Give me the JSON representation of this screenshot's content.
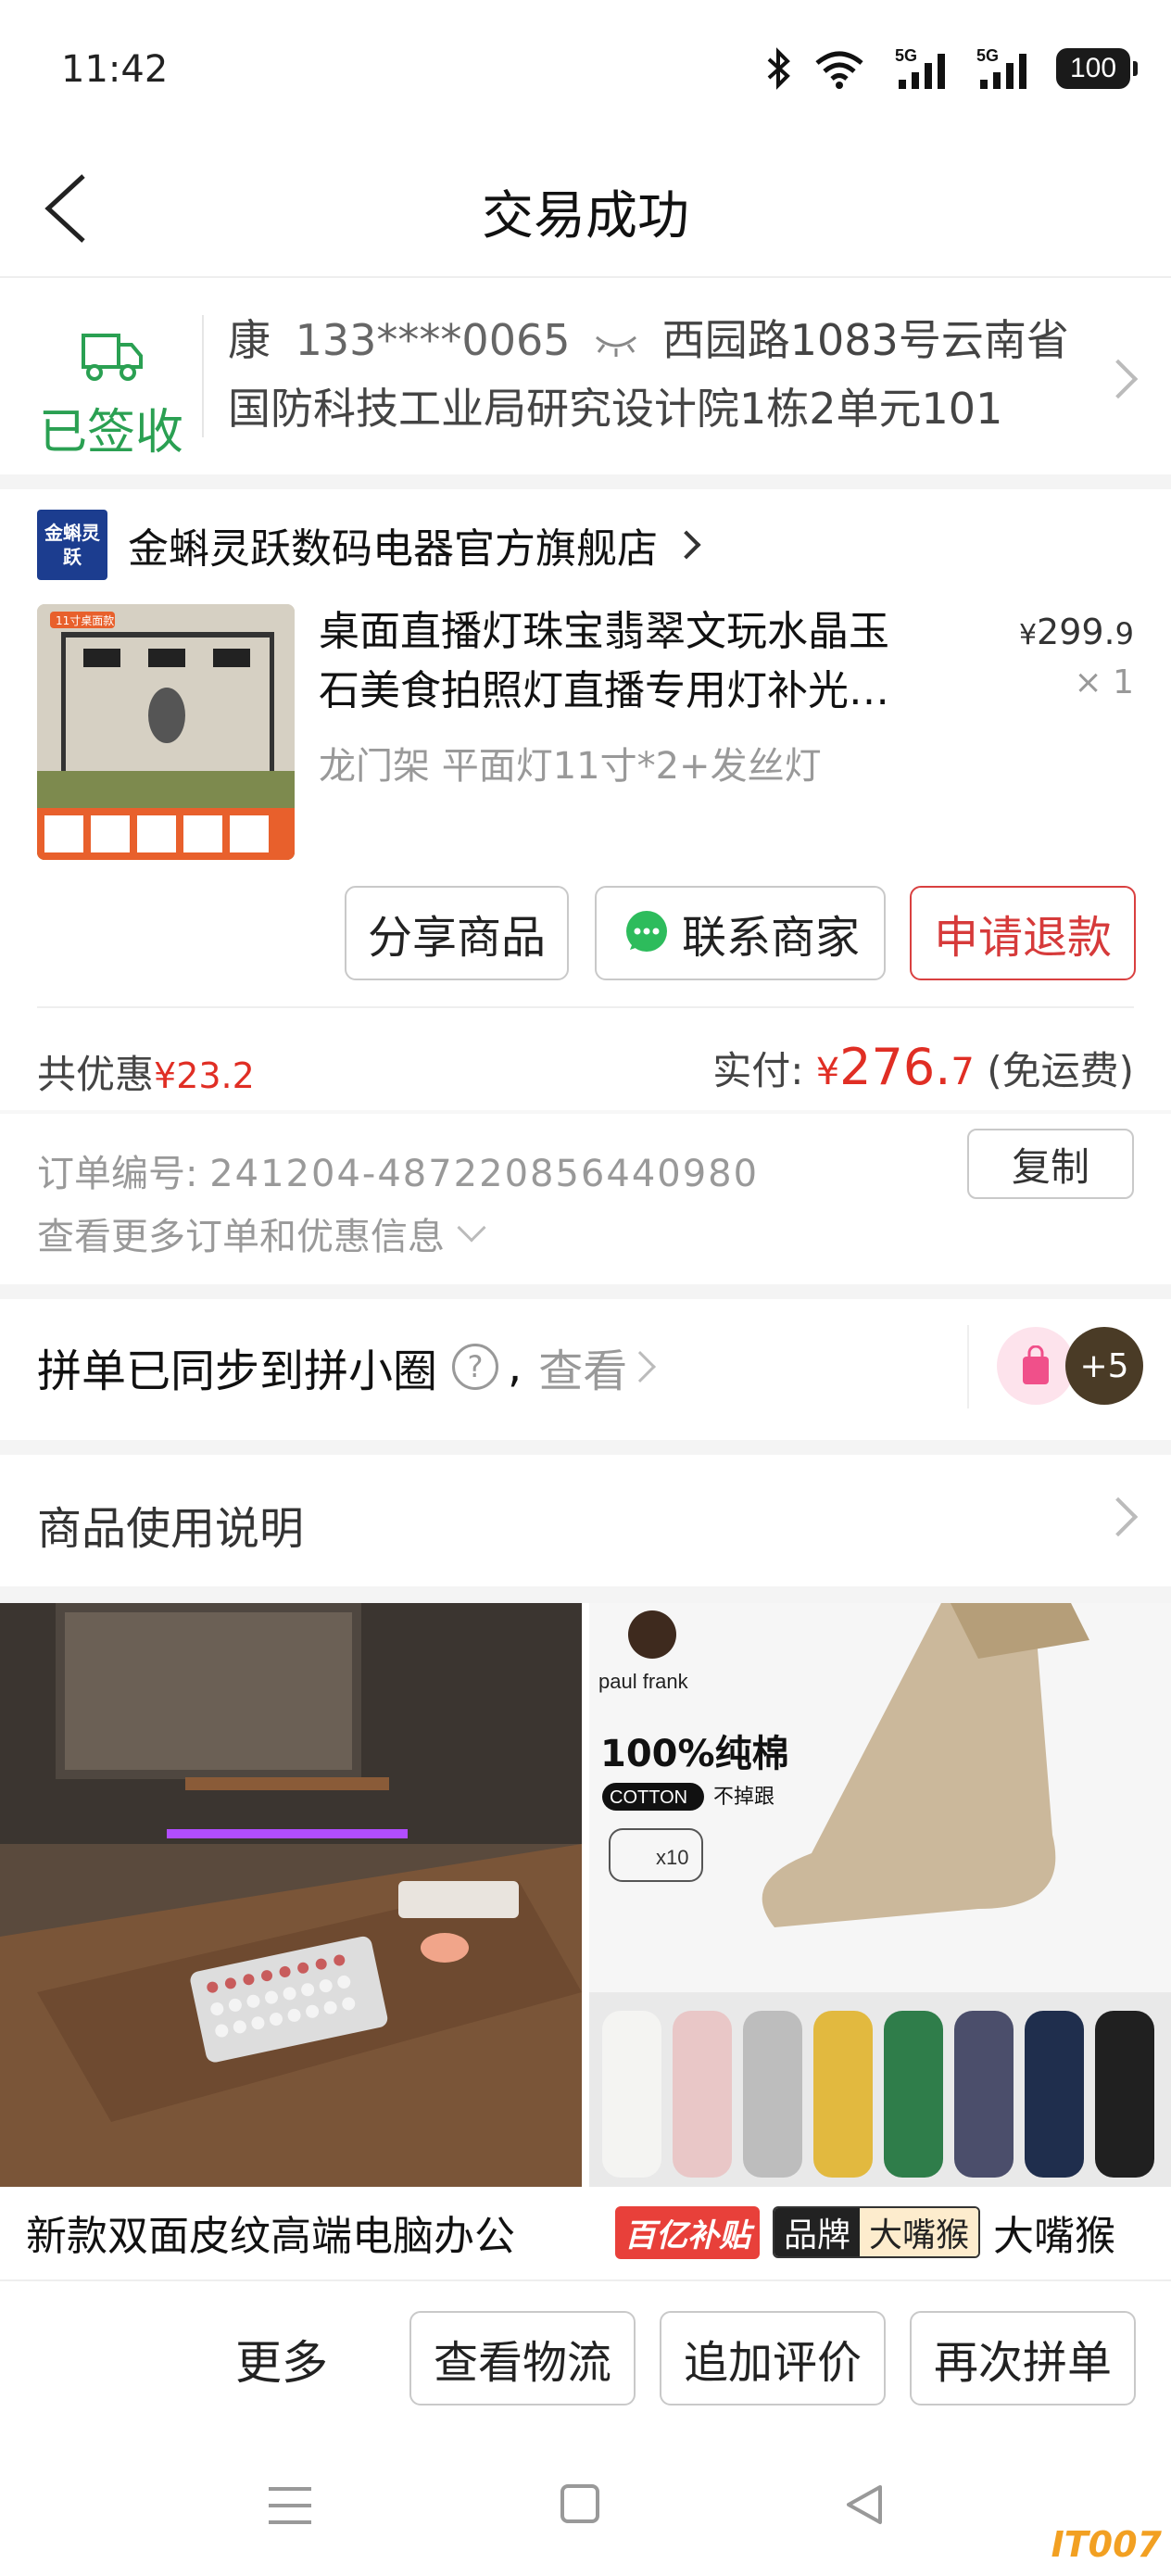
{
  "status_bar": {
    "time": "11:42",
    "battery": "100",
    "signal_label": "5G"
  },
  "nav": {
    "title": "交易成功"
  },
  "address": {
    "status": "已签收",
    "name": "康",
    "phone": "133****0065",
    "line1": "西园路1083号云南省",
    "line2": "国防科技工业局研究设计院1栋2单元101"
  },
  "shop": {
    "logo_text": "金蝌灵跃",
    "name": "金蝌灵跃数码电器官方旗舰店"
  },
  "product": {
    "thumb_badge": "11寸桌面款",
    "name_line1": "桌面直播灯珠宝翡翠文玩水晶玉",
    "name_line2": "石美食拍照灯直播专用灯补光…",
    "spec": "龙门架 平面灯11寸*2+发丝灯",
    "price_symbol": "¥",
    "price_int": "299.",
    "price_dec": "9",
    "qty_symbol": "×",
    "qty": "1"
  },
  "actions": {
    "share": "分享商品",
    "contact": "联系商家",
    "refund": "申请退款"
  },
  "summary": {
    "discount_label": "共优惠",
    "discount_value": "¥23.2",
    "paid_label": "实付:",
    "paid_symbol": "¥",
    "paid_int": "276.",
    "paid_dec": "7",
    "paid_note": "(免运费)"
  },
  "order": {
    "label": "订单编号:",
    "number": "241204-487220856440980",
    "copy": "复制",
    "more": "查看更多订单和优惠信息"
  },
  "group": {
    "text": "拼单已同步到拼小圈",
    "help": "?",
    "comma": ",",
    "view": "查看",
    "avatar_more": "+5"
  },
  "usage": {
    "label": "商品使用说明"
  },
  "recommend": [
    {
      "title": "新款双面皮纹高端电脑办公"
    },
    {
      "tag_subsidy": "百亿补贴",
      "tag_brand_a": "品牌",
      "tag_brand_b": "大嘴猴",
      "title": "大嘴猴",
      "img_brand": "paul frank",
      "img_headline": "100%纯棉",
      "img_cotton": "COTTON",
      "img_cotton_note": "不掉跟",
      "img_count": "x10"
    }
  ],
  "bottom_bar": {
    "more": "更多",
    "logistics": "查看物流",
    "review": "追加评价",
    "rebuy": "再次拼单"
  },
  "watermark": "IT007",
  "colors": {
    "accent_red": "#e02e24",
    "signed_green": "#2aa052"
  }
}
